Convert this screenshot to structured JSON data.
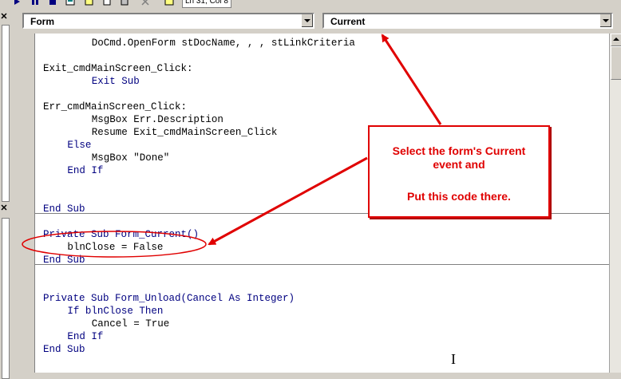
{
  "toolbar": {
    "status_text": "Ln 31, Col 8"
  },
  "combos": {
    "object": {
      "value": "Form"
    },
    "procedure": {
      "value": "Current"
    }
  },
  "code": {
    "lines": [
      {
        "indent": "        ",
        "text": "DoCmd.OpenForm stDocName, , , stLinkCriteria",
        "kw": ""
      },
      {
        "indent": "",
        "text": "",
        "kw": ""
      },
      {
        "indent": "",
        "text": "Exit_cmdMainScreen_Click:",
        "kw": ""
      },
      {
        "indent": "        ",
        "text": "Exit Sub",
        "kw": "kw"
      },
      {
        "indent": "",
        "text": "",
        "kw": ""
      },
      {
        "indent": "",
        "text": "Err_cmdMainScreen_Click:",
        "kw": ""
      },
      {
        "indent": "        ",
        "text": "MsgBox Err.Description",
        "kw": ""
      },
      {
        "indent": "        ",
        "text": "Resume Exit_cmdMainScreen_Click",
        "kw": "mix"
      },
      {
        "indent": "    ",
        "text": "Else",
        "kw": "kw"
      },
      {
        "indent": "        ",
        "text": "MsgBox \"Done\"",
        "kw": ""
      },
      {
        "indent": "    ",
        "text": "End If",
        "kw": "kw"
      },
      {
        "indent": "",
        "text": "",
        "kw": ""
      },
      {
        "indent": "",
        "text": "",
        "kw": ""
      },
      {
        "indent": "",
        "text": "End Sub",
        "kw": "kw"
      },
      {
        "indent": "",
        "text": "",
        "kw": ""
      },
      {
        "indent": "",
        "text": "Private Sub Form_Current()",
        "kw": "kw"
      },
      {
        "indent": "    ",
        "text": "blnClose = False",
        "kw": ""
      },
      {
        "indent": "",
        "text": "End Sub",
        "kw": "kw"
      },
      {
        "indent": "",
        "text": "",
        "kw": ""
      },
      {
        "indent": "",
        "text": "",
        "kw": ""
      },
      {
        "indent": "",
        "text": "Private Sub Form_Unload(Cancel As Integer)",
        "kw": "kw"
      },
      {
        "indent": "    ",
        "text": "If blnClose Then",
        "kw": "kw"
      },
      {
        "indent": "        ",
        "text": "Cancel = True",
        "kw": ""
      },
      {
        "indent": "    ",
        "text": "End If",
        "kw": "kw"
      },
      {
        "indent": "",
        "text": "End Sub",
        "kw": "kw"
      }
    ]
  },
  "callout": {
    "line1": "Select the form's Current",
    "line2": "event and",
    "line3": "Put this code there."
  },
  "colors": {
    "annotation": "#e00000",
    "keyword": "#000080"
  }
}
